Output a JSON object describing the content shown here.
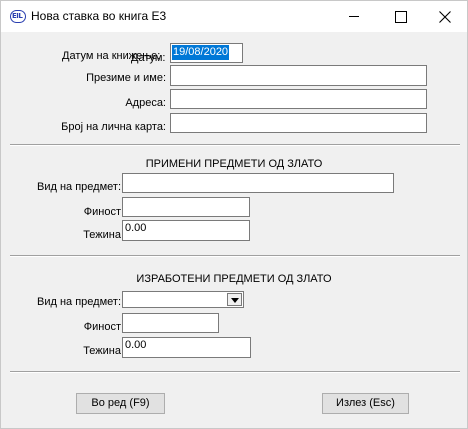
{
  "window": {
    "title": "Нова ставка во книга Е3"
  },
  "header_form": {
    "date_label": "Датум на книжење:",
    "date_label_overlay": "Датум:",
    "date_value": "19/08/2020",
    "name_label": "Презиме и име:",
    "name_value": "",
    "address_label": "Адреса:",
    "address_value": "",
    "id_label": "Број на лична карта:",
    "id_value": ""
  },
  "used_section": {
    "title": "ПРИМЕНИ ПРЕДМЕТИ ОД ЗЛАТО",
    "type_label": "Вид на предмет:",
    "type_value": "",
    "fineness_label": "Финост",
    "fineness_value": "",
    "weight_label": "Тежина",
    "weight_value": "0.00"
  },
  "made_section": {
    "title": "ИЗРАБОТЕНИ ПРЕДМЕТИ ОД ЗЛАТО",
    "type_label": "Вид на предмет:",
    "type_value": "",
    "fineness_label": "Финост",
    "fineness_value": "",
    "weight_label": "Тежина",
    "weight_value": "0.00"
  },
  "buttons": {
    "ok_label": "Во ред (F9)",
    "exit_label": "Излез (Esc)"
  }
}
